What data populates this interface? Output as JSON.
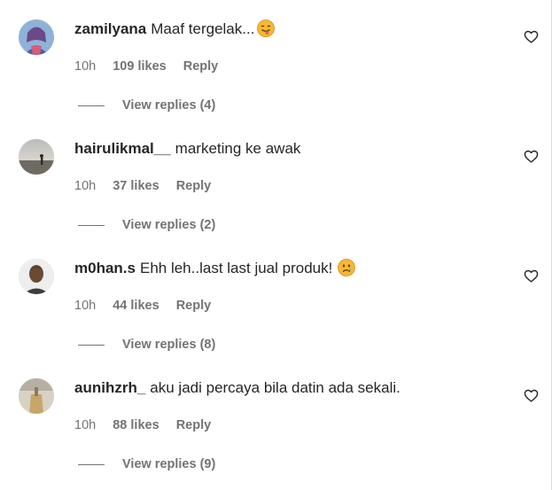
{
  "comments": [
    {
      "username": "zamilyana",
      "text": "Maaf tergelak...",
      "emoji": "tongue-out-emoji",
      "time": "10h",
      "likes": "109 likes",
      "reply_label": "Reply",
      "replies_label": "View replies (4)"
    },
    {
      "username": "hairulikmal__",
      "text": "marketing ke awak",
      "emoji": "",
      "time": "10h",
      "likes": "37 likes",
      "reply_label": "Reply",
      "replies_label": "View replies (2)"
    },
    {
      "username": "m0han.s",
      "text": "Ehh leh..last last jual produk!",
      "emoji": "sad-face-emoji",
      "time": "10h",
      "likes": "44 likes",
      "reply_label": "Reply",
      "replies_label": "View replies (8)"
    },
    {
      "username": "aunihzrh_",
      "text": "aku jadi percaya bila datin ada sekali.",
      "emoji": "",
      "time": "10h",
      "likes": "88 likes",
      "reply_label": "Reply",
      "replies_label": "View replies (9)"
    }
  ],
  "colors": {
    "text_primary": "#262626",
    "text_secondary": "#737373",
    "emoji_yellow": "#f7b733"
  }
}
